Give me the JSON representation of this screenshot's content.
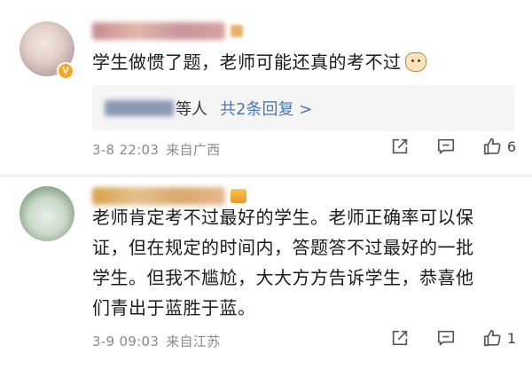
{
  "comments": [
    {
      "username": "",
      "avatar": "avatar",
      "verified_badge": "V",
      "text": "学生做惯了题，老师可能还真的考不过",
      "emoji": "cat-face-icon",
      "reply_summary": {
        "suffix": "等人",
        "link": "共2条回复 >"
      },
      "time": "3-8 22:03",
      "location": "来自广西",
      "likes": "6"
    },
    {
      "username": "",
      "avatar": "avatar",
      "level_badge": "crown-icon",
      "text_lines": [
        "老师肯定考不过最好的学生。老师正确率可以保",
        "证，但在规定的时间内，答题答不过最好的一批",
        "学生。但我不尴尬，大大方方告诉学生，恭喜他",
        "们青出于蓝胜于蓝。"
      ],
      "time": "3-9 09:03",
      "location": "来自江苏",
      "likes": "1"
    }
  ],
  "colors": {
    "link": "#4a79b0",
    "meta": "#8a8a8a",
    "reply_bg": "#f5f5f5"
  }
}
